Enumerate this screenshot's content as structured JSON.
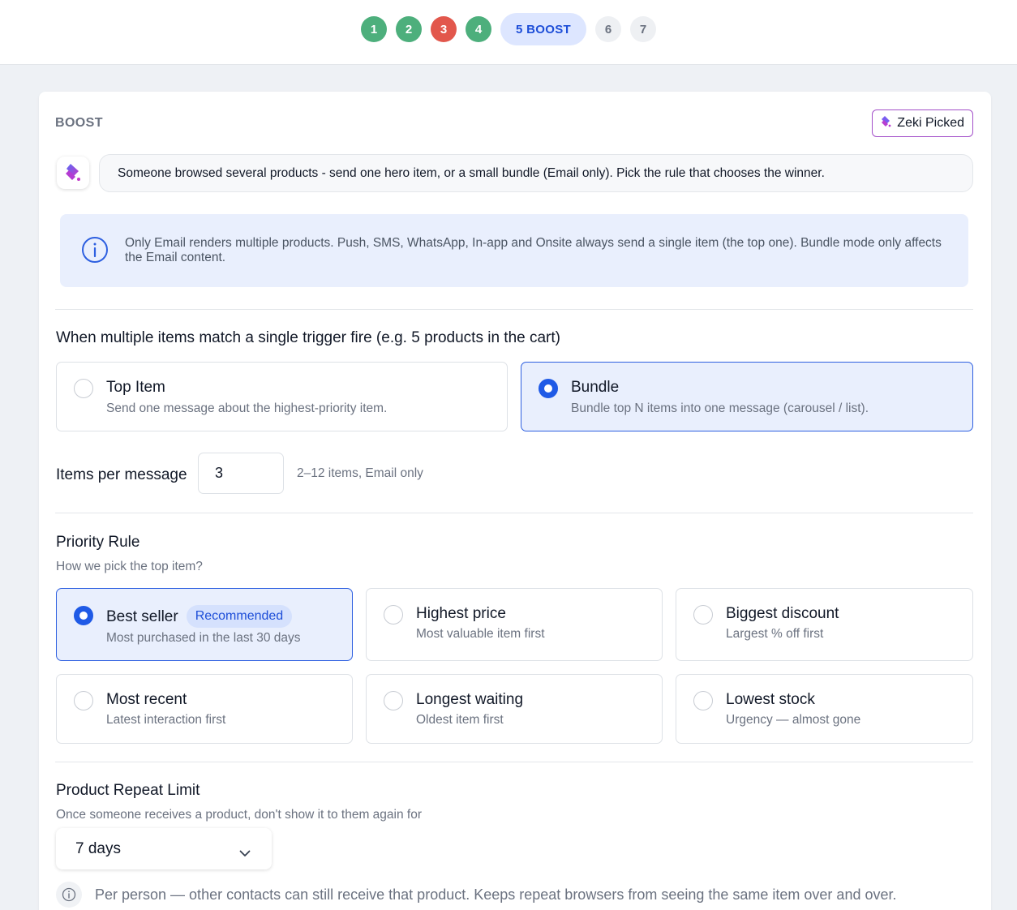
{
  "steps": [
    {
      "label": "1",
      "state": "done"
    },
    {
      "label": "2",
      "state": "done"
    },
    {
      "label": "3",
      "state": "error"
    },
    {
      "label": "4",
      "state": "done"
    },
    {
      "label": "5 BOOST",
      "state": "active"
    },
    {
      "label": "6",
      "state": "future"
    },
    {
      "label": "7",
      "state": "future"
    }
  ],
  "header": {
    "section_label": "BOOST",
    "zeki_badge": "Zeki Picked",
    "hint": "Someone browsed several products - send one hero item, or a small bundle (Email only). Pick the rule that chooses the winner."
  },
  "info": {
    "text": "Only Email renders multiple products. Push, SMS, WhatsApp, In-app and Onsite always send a single item (the top one). Bundle mode only affects the Email content."
  },
  "multi": {
    "title": "When multiple items match a single trigger fire (e.g. 5 products in the cart)",
    "options": [
      {
        "title": "Top Item",
        "desc": "Send one message about the highest-priority item.",
        "selected": false
      },
      {
        "title": "Bundle",
        "desc": "Bundle top N items into one message (carousel / list).",
        "selected": true
      }
    ],
    "items_label": "Items per message",
    "items_value": "3",
    "items_help": "2–12 items, Email only"
  },
  "priority": {
    "title": "Priority Rule",
    "subtitle": "How we pick the top item?",
    "recommended_label": "Recommended",
    "options": [
      {
        "title": "Best seller",
        "desc": "Most purchased in the last 30 days",
        "selected": true
      },
      {
        "title": "Highest price",
        "desc": "Most valuable item first",
        "selected": false
      },
      {
        "title": "Biggest discount",
        "desc": "Largest % off first",
        "selected": false
      },
      {
        "title": "Most recent",
        "desc": "Latest interaction first",
        "selected": false
      },
      {
        "title": "Longest waiting",
        "desc": "Oldest item first",
        "selected": false
      },
      {
        "title": "Lowest stock",
        "desc": "Urgency — almost gone",
        "selected": false
      }
    ]
  },
  "repeat": {
    "title": "Product Repeat Limit",
    "subtitle": "Once someone receives a product, don't show it to them again for",
    "selected_value": "7 days",
    "note": "Per person — other contacts can still receive that product. Keeps repeat browsers from seeing the same item over and over."
  },
  "colors": {
    "accent": "#1f5ae6",
    "step_done": "#4daf7c",
    "step_error": "#e2574c",
    "zeki_border": "#a34fc9"
  }
}
